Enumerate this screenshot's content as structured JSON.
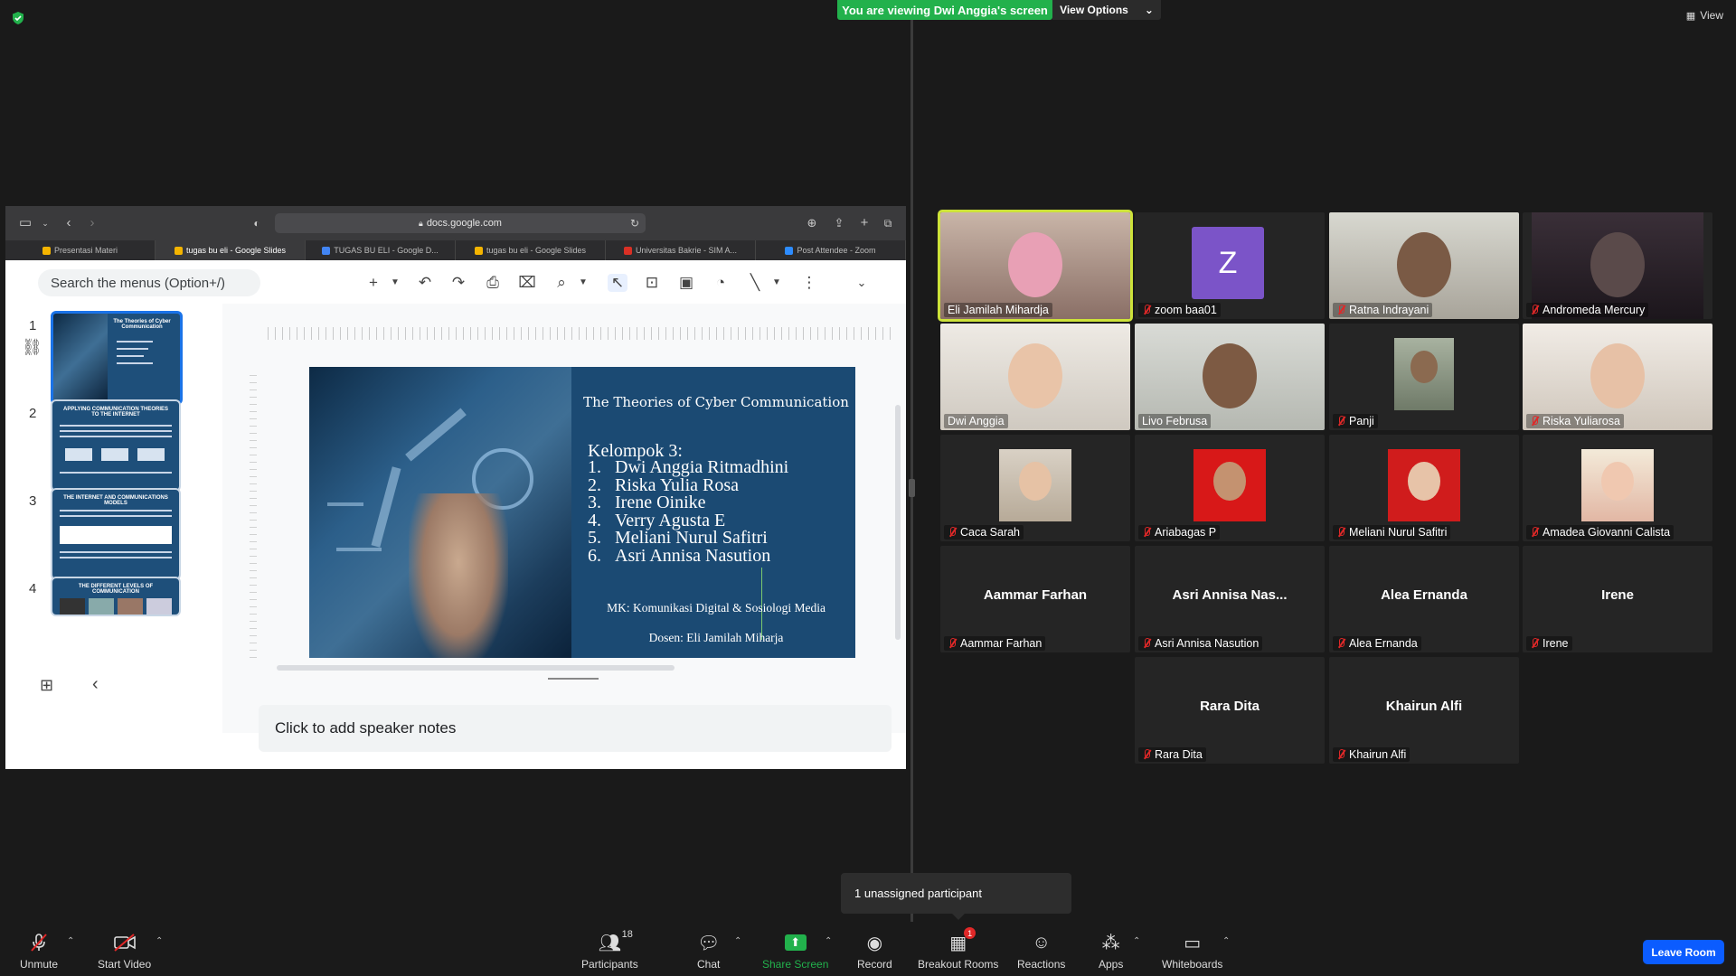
{
  "zoom": {
    "viewing_banner": "You are viewing Dwi Anggia's screen",
    "view_options": "View Options",
    "view_button": "View",
    "unassigned_popup": "1 unassigned participant",
    "leave_button": "Leave Room",
    "toolbar": {
      "unmute": "Unmute",
      "start_video": "Start Video",
      "participants": "Participants",
      "participants_count": "18",
      "chat": "Chat",
      "share_screen": "Share Screen",
      "record": "Record",
      "breakout_rooms": "Breakout Rooms",
      "breakout_badge": "1",
      "reactions": "Reactions",
      "apps": "Apps",
      "whiteboards": "Whiteboards"
    }
  },
  "browser": {
    "url": "docs.google.com",
    "tabs": [
      {
        "label": "Presentasi Materi",
        "color": "#f4b400"
      },
      {
        "label": "tugas bu eli - Google Slides",
        "color": "#f4b400"
      },
      {
        "label": "TUGAS BU ELI - Google D...",
        "color": "#4285f4"
      },
      {
        "label": "tugas bu eli - Google Slides",
        "color": "#f4b400"
      },
      {
        "label": "Universitas Bakrie - SIM A...",
        "color": "#d93025"
      },
      {
        "label": "Post Attendee - Zoom",
        "color": "#2d8cff"
      }
    ]
  },
  "slides_app": {
    "search_placeholder": "Search the menus (Option+/)",
    "slide_numbers": [
      "1",
      "2",
      "3",
      "4"
    ],
    "thumb_titles": [
      "The Theories of Cyber Communication",
      "APPLYING COMMUNICATION THEORIES TO THE INTERNET",
      "THE INTERNET AND COMMUNICATIONS MODELS",
      "THE DIFFERENT LEVELS OF COMMUNICATION"
    ],
    "speaker_notes": "Click to add speaker notes"
  },
  "slide": {
    "title": "The Theories of Cyber Communication",
    "group": "Kelompok 3:",
    "members": [
      {
        "n": "1.",
        "name": "Dwi Anggia Ritmadhini"
      },
      {
        "n": "2.",
        "name": "Riska Yulia Rosa"
      },
      {
        "n": "3.",
        "name": "Irene Oinike"
      },
      {
        "n": "4.",
        "name": "Verry Agusta E"
      },
      {
        "n": "5.",
        "name": "Meliani Nurul Safitri"
      },
      {
        "n": "6.",
        "name": "Asri Annisa Nasution"
      }
    ],
    "course": "MK: Komunikasi Digital & Sosiologi Media",
    "lecturer": "Dosen: Eli Jamilah Miharja"
  },
  "participants": [
    {
      "name": "Eli Jamilah Mihardja",
      "kind": "video",
      "muted": false,
      "active": true
    },
    {
      "name": "zoom baa01",
      "kind": "avatar",
      "avatar": "Z",
      "muted": true
    },
    {
      "name": "Ratna Indrayani",
      "kind": "video",
      "muted": true
    },
    {
      "name": "Andromeda Mercury",
      "kind": "video",
      "muted": true
    },
    {
      "name": "Dwi Anggia",
      "kind": "video",
      "muted": false
    },
    {
      "name": "Livo Februsa",
      "kind": "video",
      "muted": false
    },
    {
      "name": "Panji",
      "kind": "video",
      "muted": true
    },
    {
      "name": "Riska Yuliarosa",
      "kind": "video",
      "muted": true
    },
    {
      "name": "Caca Sarah",
      "kind": "video",
      "muted": true
    },
    {
      "name": "Ariabagas P",
      "kind": "video",
      "muted": true
    },
    {
      "name": "Meliani Nurul Safitri",
      "kind": "video",
      "muted": true
    },
    {
      "name": "Amadea Giovanni Calista",
      "kind": "video",
      "muted": true
    },
    {
      "name": "Aammar Farhan",
      "kind": "name",
      "display": "Aammar Farhan",
      "muted": true
    },
    {
      "name": "Asri Annisa Nasution",
      "kind": "name",
      "display": "Asri Annisa Nas...",
      "muted": true
    },
    {
      "name": "Alea Ernanda",
      "kind": "name",
      "display": "Alea Ernanda",
      "muted": true
    },
    {
      "name": "Irene",
      "kind": "name",
      "display": "Irene",
      "muted": true
    },
    {
      "name": "Rara Dita",
      "kind": "name",
      "display": "Rara Dita",
      "muted": true
    },
    {
      "name": "Khairun Alfi",
      "kind": "name",
      "display": "Khairun Alfi",
      "muted": true
    }
  ]
}
